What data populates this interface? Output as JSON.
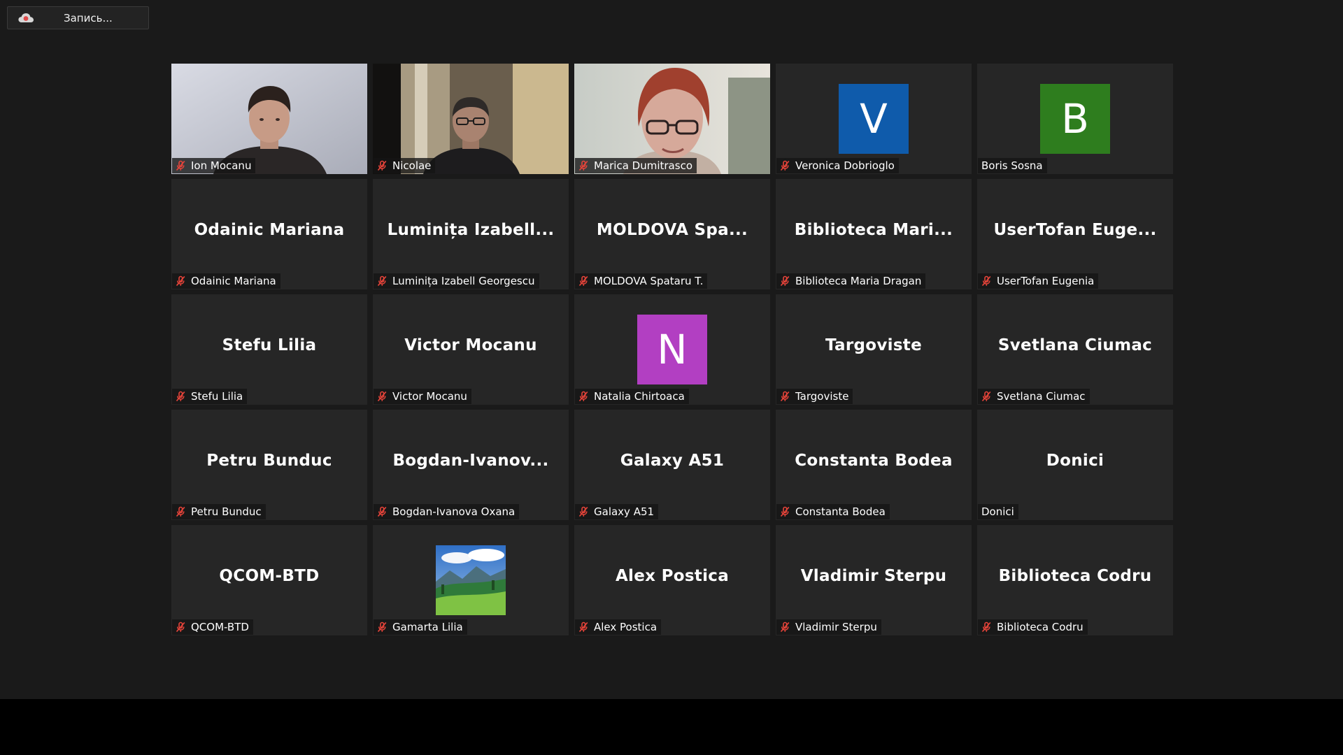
{
  "recording": {
    "label": "Запись...",
    "icon": "cloud-record-icon",
    "accent": "#e04a4a"
  },
  "colors": {
    "mute_icon": "#e8443a",
    "avatar_v": "#0f5bab",
    "avatar_b": "#2e7d1e",
    "avatar_n": "#b23fc2"
  },
  "tiles": [
    {
      "kind": "video",
      "video": "person-1",
      "tag": "Ion Mocanu",
      "muted": true
    },
    {
      "kind": "video",
      "video": "person-2",
      "tag": "Nicolae",
      "muted": true
    },
    {
      "kind": "video",
      "video": "person-3",
      "tag": "Marica Dumitrasco",
      "muted": true
    },
    {
      "kind": "avatar",
      "letter": "V",
      "color": "#0f5bab",
      "tag": "Veronica Dobrioglo",
      "muted": true
    },
    {
      "kind": "avatar",
      "letter": "B",
      "color": "#2e7d1e",
      "tag": "Boris Sosna",
      "muted": false
    },
    {
      "kind": "name",
      "big": "Odainic Mariana",
      "tag": "Odainic Mariana",
      "muted": true
    },
    {
      "kind": "name",
      "big": "Luminița  Izabell...",
      "tag": "Luminița Izabell Georgescu",
      "muted": true
    },
    {
      "kind": "name",
      "big": "MOLDOVA  Spa...",
      "tag": "MOLDOVA  Spataru T.",
      "muted": true
    },
    {
      "kind": "name",
      "big": "Biblioteca  Mari...",
      "tag": "Biblioteca Maria Dragan",
      "muted": true
    },
    {
      "kind": "name",
      "big": "UserTofan  Euge...",
      "tag": "UserTofan Eugenia",
      "muted": true
    },
    {
      "kind": "name",
      "big": "Stefu Lilia",
      "tag": "Stefu Lilia",
      "muted": true
    },
    {
      "kind": "name",
      "big": "Victor Mocanu",
      "tag": "Victor Mocanu",
      "muted": true
    },
    {
      "kind": "avatar",
      "letter": "N",
      "color": "#b23fc2",
      "tag": "Natalia Chirtoaca",
      "muted": true
    },
    {
      "kind": "name",
      "big": "Targoviste",
      "tag": "Targoviste",
      "muted": true
    },
    {
      "kind": "name",
      "big": "Svetlana Ciumac",
      "tag": "Svetlana Ciumac",
      "muted": true
    },
    {
      "kind": "name",
      "big": "Petru Bunduc",
      "tag": "Petru Bunduc",
      "muted": true
    },
    {
      "kind": "name",
      "big": "Bogdan-Ivanov...",
      "tag": "Bogdan-Ivanova Oxana",
      "muted": true
    },
    {
      "kind": "name",
      "big": "Galaxy A51",
      "tag": "Galaxy A51",
      "muted": true
    },
    {
      "kind": "name",
      "big": "Constanta Bodea",
      "tag": "Constanta Bodea",
      "muted": true
    },
    {
      "kind": "name",
      "big": "Donici",
      "tag": "Donici",
      "muted": false
    },
    {
      "kind": "name",
      "big": "QCOM-BTD",
      "tag": "QCOM-BTD",
      "muted": true
    },
    {
      "kind": "image",
      "image": "landscape-photo",
      "tag": "Gamarta Lilia",
      "muted": true
    },
    {
      "kind": "name",
      "big": "Alex Postica",
      "tag": "Alex Postica",
      "muted": true
    },
    {
      "kind": "name",
      "big": "Vladimir Sterpu",
      "tag": "Vladimir Sterpu",
      "muted": true
    },
    {
      "kind": "name",
      "big": "Biblioteca Codru",
      "tag": "Biblioteca Codru",
      "muted": true
    }
  ]
}
